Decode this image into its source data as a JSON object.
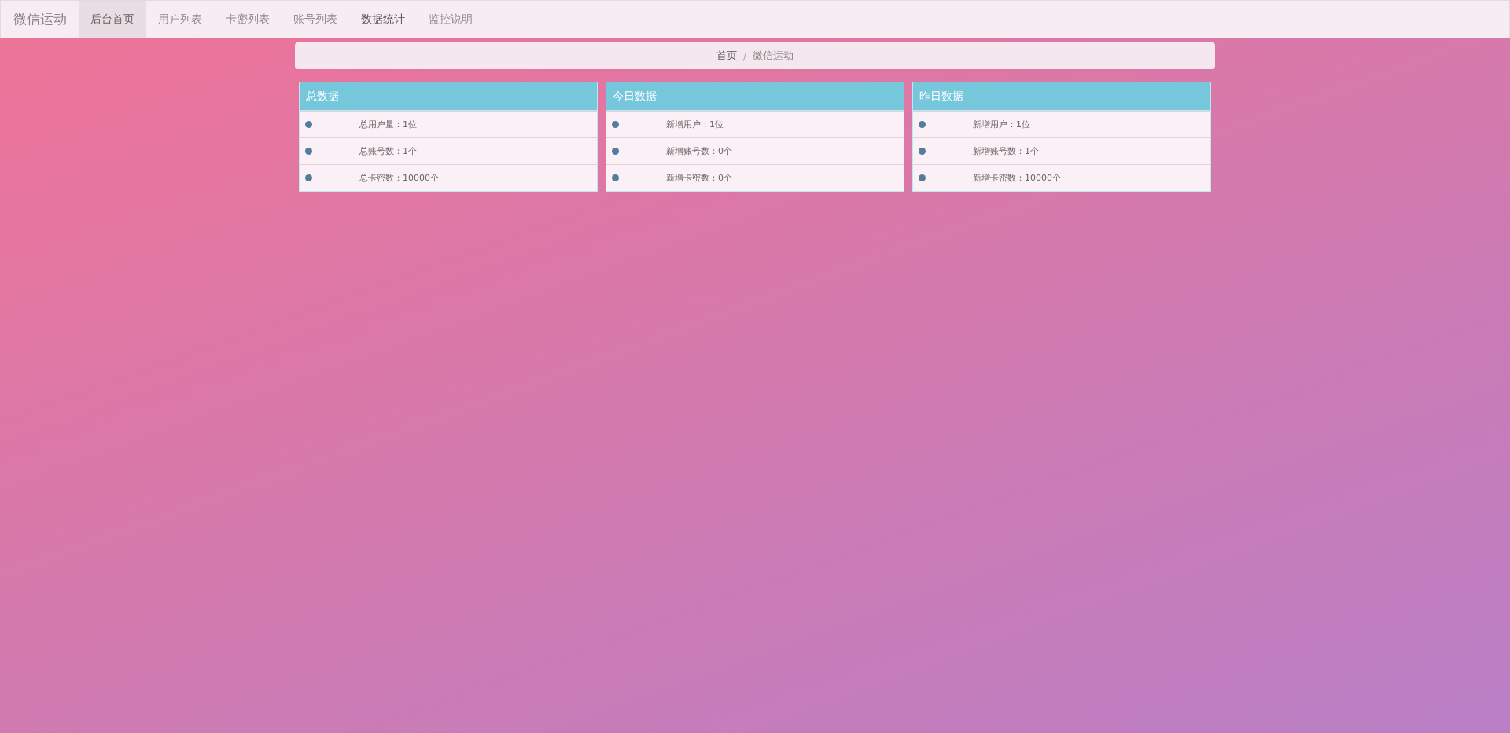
{
  "navbar": {
    "brand": "微信运动",
    "items": [
      {
        "label": "后台首页",
        "selected": true,
        "highlighted": false
      },
      {
        "label": "用户列表",
        "selected": false,
        "highlighted": false
      },
      {
        "label": "卡密列表",
        "selected": false,
        "highlighted": false
      },
      {
        "label": "账号列表",
        "selected": false,
        "highlighted": false
      },
      {
        "label": "数据统计",
        "selected": false,
        "highlighted": true
      },
      {
        "label": "监控说明",
        "selected": false,
        "highlighted": false
      }
    ]
  },
  "breadcrumb": [
    "首页",
    "微信运动"
  ],
  "breadcrumb_separator": "/",
  "panels": [
    {
      "title": "总数据",
      "rows": [
        "总用户量：1位",
        "总账号数：1个",
        "总卡密数：10000个"
      ]
    },
    {
      "title": "今日数据",
      "rows": [
        "新增用户：1位",
        "新增账号数：0个",
        "新增卡密数：0个"
      ]
    },
    {
      "title": "昨日数据",
      "rows": [
        "新增用户：1位",
        "新增账号数：1个",
        "新增卡密数：10000个"
      ]
    }
  ]
}
